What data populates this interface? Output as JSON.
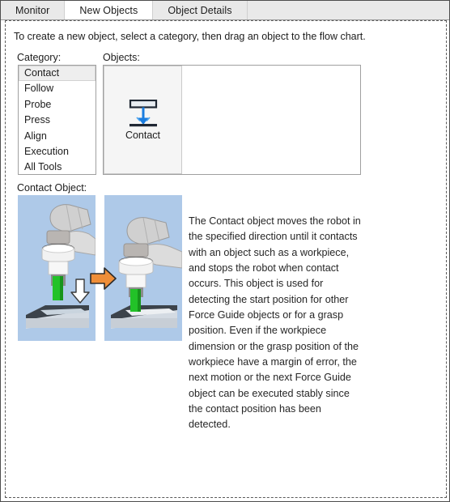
{
  "window": {
    "tabs": [
      {
        "label": "Monitor",
        "selected": false
      },
      {
        "label": "New Objects",
        "selected": true
      },
      {
        "label": "Object Details",
        "selected": false
      }
    ]
  },
  "main": {
    "intro_text": "To create a new object, select a category, then drag an object to the flow chart.",
    "category_label": "Category:",
    "objects_label": "Objects:",
    "contact_object_label": "Contact Object:",
    "categories": [
      {
        "label": "Contact",
        "selected": true
      },
      {
        "label": "Follow",
        "selected": false
      },
      {
        "label": "Probe",
        "selected": false
      },
      {
        "label": "Press",
        "selected": false
      },
      {
        "label": "Align",
        "selected": false
      },
      {
        "label": "Execution",
        "selected": false
      },
      {
        "label": "All Tools",
        "selected": false
      }
    ],
    "objects": [
      {
        "label": "Contact",
        "icon": "contact-arrow-icon"
      }
    ],
    "description": "The Contact object moves the robot in the specified direction until it contacts with an object such as a workpiece, and stops the robot when contact occurs.  This object is used for detecting the start position for other Force Guide objects or for a grasp position.  Even if the workpiece dimension or the grasp position of the workpiece have a margin of error, the next motion or the next Force Guide object can be executed stably since the contact position has been detected.",
    "illustrations": {
      "before": {
        "name": "robot-before-contact-image"
      },
      "after": {
        "name": "robot-after-contact-image"
      },
      "transition_icon": "orange-right-arrow-icon"
    }
  },
  "colors": {
    "tab_selected_bg": "#ffffff",
    "tab_bg": "#e9e9e9",
    "illustration_bg": "#aec9e8",
    "arrow_blue": "#1a7de0",
    "arrow_orange": "#ef8e38",
    "gripper_green": "#22c228",
    "panel_border": "#a0a0a0"
  }
}
